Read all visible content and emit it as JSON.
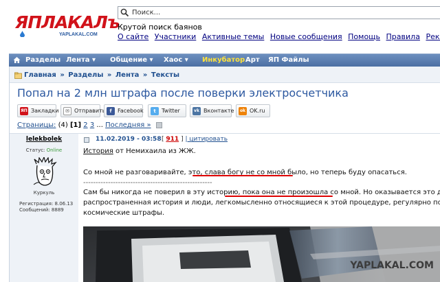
{
  "logo": {
    "text": "ЯПЛАКАЛъ",
    "url": "YAPLAKAL.COM"
  },
  "search": {
    "placeholder": "Поиск..."
  },
  "header": {
    "tagline": "Крутой поиск баянов",
    "links": [
      "О сайте",
      "Участники",
      "Активные темы",
      "Новые сообщения",
      "Помощь",
      "Правила",
      "Реклама"
    ]
  },
  "nav": {
    "items": [
      "Разделы",
      "Лента ▾",
      "Общение ▾",
      "Хаос ▾",
      "Инкубатор",
      "Арт",
      "ЯП Файлы"
    ]
  },
  "breadcrumb": {
    "items": [
      "Главная",
      "Разделы",
      "Лента",
      "Тексты"
    ],
    "sep": "»"
  },
  "topic": {
    "title": "Попал на 2 млн штрафа после поверки электросчетчика"
  },
  "share": {
    "buttons": [
      {
        "label": "Закладки",
        "icon": "yaplakal-icon",
        "color": "#d1121a",
        "glyph": "ЯП"
      },
      {
        "label": "Отправить",
        "icon": "mail-icon",
        "color": "#ffffff",
        "glyph": "✉"
      },
      {
        "label": "Facebook",
        "icon": "facebook-icon",
        "color": "#3b5998",
        "glyph": "f"
      },
      {
        "label": "Twitter",
        "icon": "twitter-icon",
        "color": "#55acee",
        "glyph": "t"
      },
      {
        "label": "Вконтакте",
        "icon": "vk-icon",
        "color": "#4c75a3",
        "glyph": "vk"
      },
      {
        "label": "OK.ru",
        "icon": "ok-icon",
        "color": "#ee8208",
        "glyph": "ok"
      }
    ]
  },
  "pagination": {
    "label": "Страницы:",
    "count": "(4)",
    "current": "[1]",
    "pages": [
      "2",
      "3"
    ],
    "dots": "...",
    "last": "Последняя »"
  },
  "post": {
    "author": "lelekbolek",
    "date": "11.02.2019 - 03:58",
    "rating_open": "[",
    "rating": "911",
    "rating_close": "]",
    "quote": "| цитировать",
    "status_label": "Статус:",
    "status_value": "Online",
    "avatar_caption": "Куркуль",
    "reg_line": "Регистрация: 8.06.13",
    "posts_line": "Сообщений: 8889",
    "line1_a": "История",
    "line1_b": " от Немихаила из ЖЖ.",
    "line2_a": "Со мной не разговаривайте, это, ",
    "line2_b": "слава богу не со мной было",
    "line2_c": ", но теперь буду опасаться.",
    "divider": "----------------------------------------------------",
    "line3_a": "Сам бы никогда не поверил в эту историю, ",
    "line3_b": "пока она не произошла со мной",
    "line3_c": ". Но оказывается это достаточно",
    "line4": "распространенная история и люди, легкомысленно относящиеся к этой процедуре, регулярно попадают на",
    "line5": "космические штрафы."
  },
  "watermark": "YAPLAKAL.COM",
  "colors": {
    "brand_red": "#d1121a",
    "nav_blue": "#5a7db0",
    "link_blue": "#1f4f8f",
    "title_blue": "#2c58a0",
    "online_green": "#3b9b3b"
  }
}
